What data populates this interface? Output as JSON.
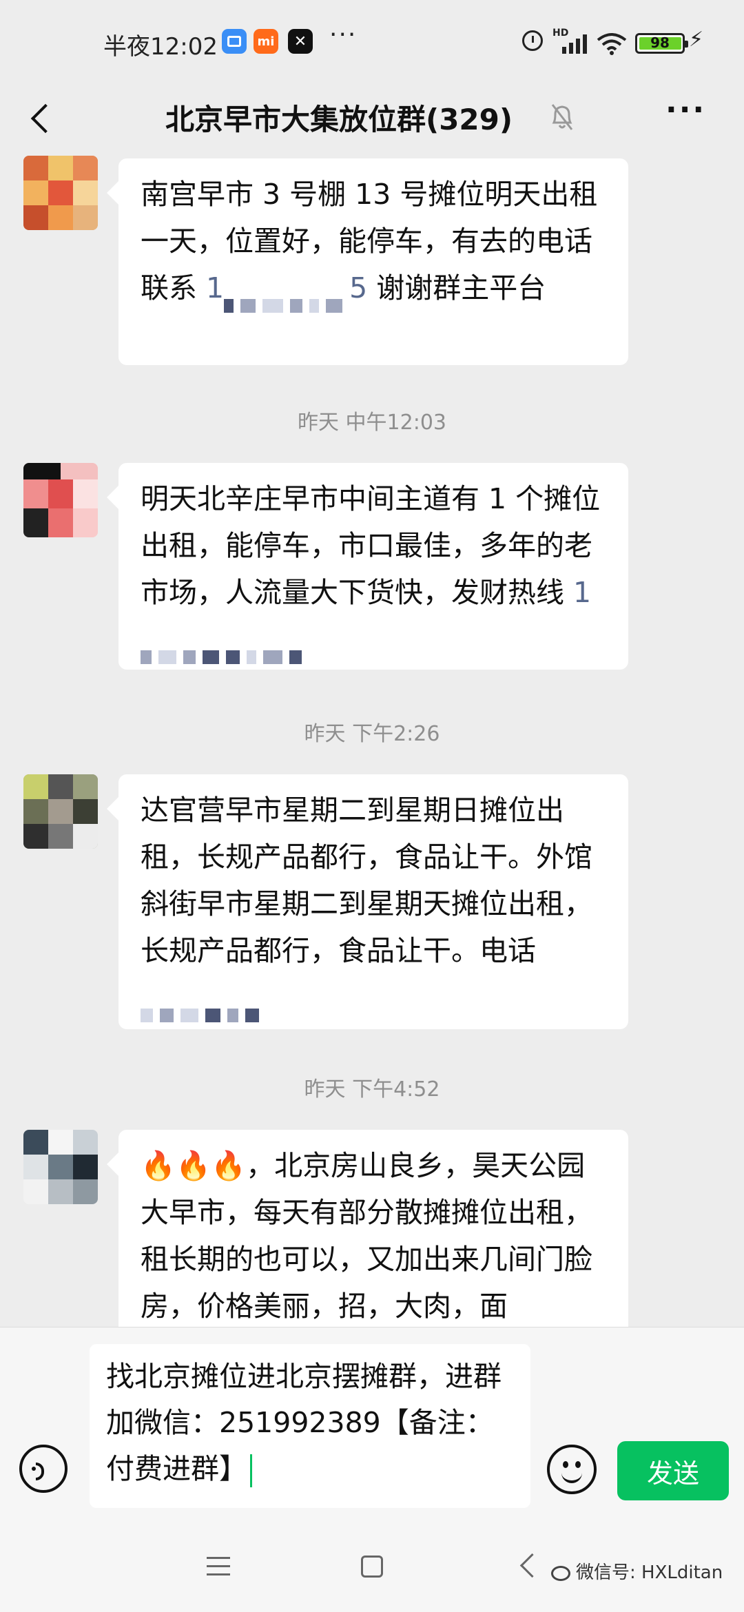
{
  "status_bar": {
    "time": "半夜12:02",
    "app_icons": [
      "calendar-app-icon",
      "mi-app-icon",
      "capcut-app-icon"
    ],
    "more": "···",
    "network": "HD",
    "battery": "98"
  },
  "header": {
    "title": "北京早市大集放位群(329)",
    "menu": "···"
  },
  "messages": [
    {
      "text_before": "南宫早市 3 号棚 13 号摊位明天出租一天，位置好，能停车，有去的电话联系 ",
      "phone_start": "1",
      "phone_end": "5",
      "text_after": " 谢谢群主平台"
    },
    {
      "timestamp": "昨天 中午12:03",
      "text_before": "明天北辛庄早市中间主道有 1 个摊位出租，能停车，市口最佳，多年的老市场，人流量大下货快，发财热线 ",
      "phone_start": "1"
    },
    {
      "timestamp": "昨天 下午2:26",
      "text_before": "达官营早市星期二到星期日摊位出租，长规产品都行，食品让干。外馆斜街早市星期二到星期天摊位出租，长规产品都行，食品让干。电话"
    },
    {
      "timestamp": "昨天 下午4:52",
      "text_before": "🔥🔥🔥，北京房山良乡，昊天公园大早市，每天有部分散摊摊位出租，租长期的也可以，又加出来几间门脸房，价格美丽，招，大肉，面"
    }
  ],
  "input": {
    "draft": "找北京摊位进北京摆摊群，进群加微信：251992389【备注：付费进群】",
    "send_label": "发送"
  },
  "watermark": "微信号: HXLditan",
  "colors": {
    "accent_green": "#07c160",
    "chat_background": "#ededed",
    "bubble": "#ffffff",
    "phone_link": "#57688d"
  }
}
